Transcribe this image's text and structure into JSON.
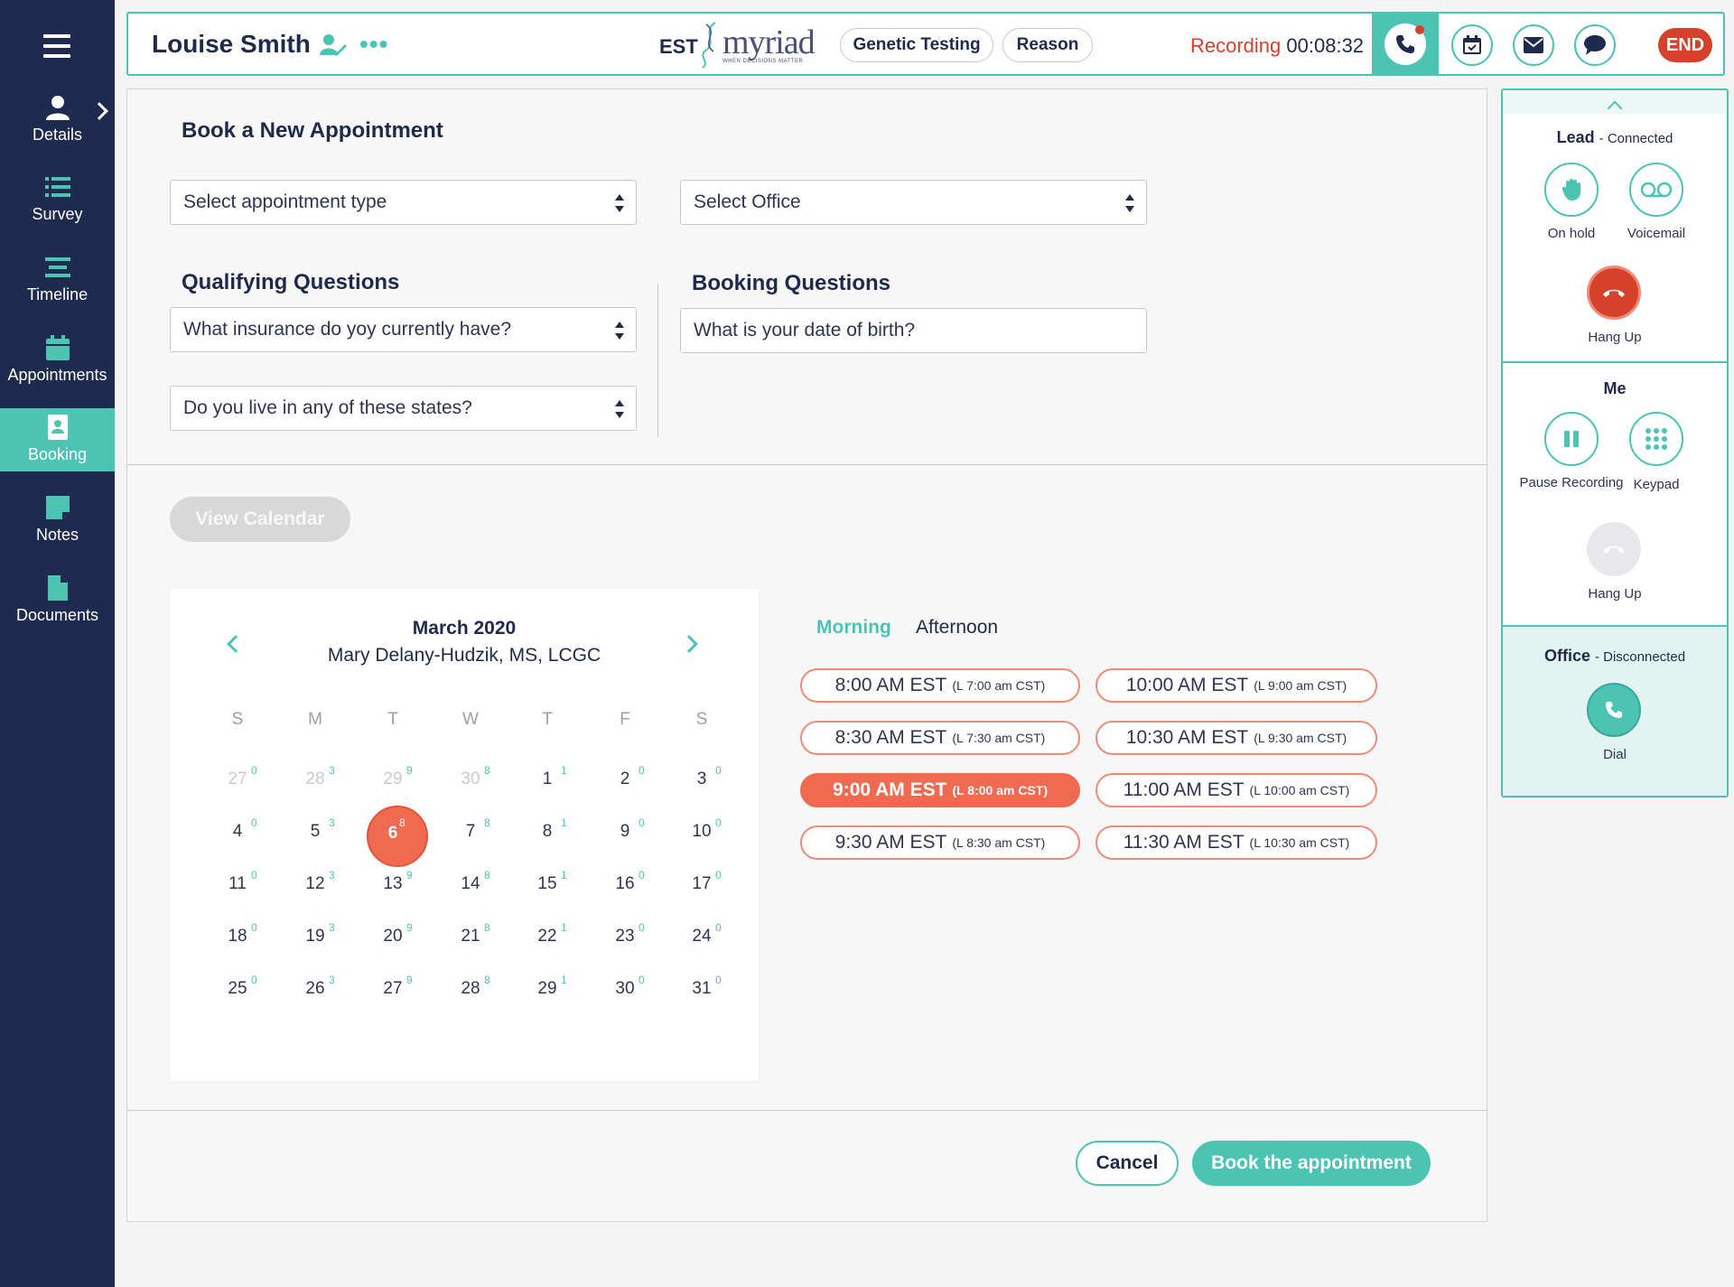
{
  "sidebar": {
    "items": [
      {
        "label": "Details"
      },
      {
        "label": "Survey"
      },
      {
        "label": "Timeline"
      },
      {
        "label": "Appointments"
      },
      {
        "label": "Booking"
      },
      {
        "label": "Notes"
      },
      {
        "label": "Documents"
      }
    ],
    "active": "Booking"
  },
  "header": {
    "patient_name": "Louise Smith",
    "timezone": "EST",
    "logo_text": "myriad",
    "logo_tagline": "WHEN DECISIONS MATTER",
    "pills": [
      "Genetic Testing",
      "Reason"
    ],
    "recording_label": "Recording",
    "recording_time": "00:08:32",
    "end_label": "END"
  },
  "booking": {
    "title": "Book a New Appointment",
    "appointment_type_placeholder": "Select appointment type",
    "office_placeholder": "Select Office",
    "qualifying_title": "Qualifying Questions",
    "qualifying_q1": "What insurance do yoy currently have?",
    "qualifying_q2": "Do you live in any of these states?",
    "booking_title": "Booking Questions",
    "booking_q1": "What is your date of birth?",
    "view_calendar": "View Calendar"
  },
  "calendar": {
    "month": "March 2020",
    "provider": "Mary Delany-Hudzik, MS, LCGC",
    "days_of_week": [
      "S",
      "M",
      "T",
      "W",
      "T",
      "F",
      "S"
    ],
    "weeks": [
      [
        {
          "d": "27",
          "c": "0",
          "f": true
        },
        {
          "d": "28",
          "c": "3",
          "f": true
        },
        {
          "d": "29",
          "c": "9",
          "f": true
        },
        {
          "d": "30",
          "c": "8",
          "f": true
        },
        {
          "d": "1",
          "c": "1"
        },
        {
          "d": "2",
          "c": "0"
        },
        {
          "d": "3",
          "c": "0"
        }
      ],
      [
        {
          "d": "4",
          "c": "0"
        },
        {
          "d": "5",
          "c": "3"
        },
        {
          "d": "6",
          "c": "8",
          "s": true
        },
        {
          "d": "7",
          "c": "8"
        },
        {
          "d": "8",
          "c": "1"
        },
        {
          "d": "9",
          "c": "0"
        },
        {
          "d": "10",
          "c": "0"
        }
      ],
      [
        {
          "d": "11",
          "c": "0"
        },
        {
          "d": "12",
          "c": "3"
        },
        {
          "d": "13",
          "c": "9"
        },
        {
          "d": "14",
          "c": "8"
        },
        {
          "d": "15",
          "c": "1"
        },
        {
          "d": "16",
          "c": "0"
        },
        {
          "d": "17",
          "c": "0"
        }
      ],
      [
        {
          "d": "18",
          "c": "0"
        },
        {
          "d": "19",
          "c": "3"
        },
        {
          "d": "20",
          "c": "9"
        },
        {
          "d": "21",
          "c": "8"
        },
        {
          "d": "22",
          "c": "1"
        },
        {
          "d": "23",
          "c": "0"
        },
        {
          "d": "24",
          "c": "0"
        }
      ],
      [
        {
          "d": "25",
          "c": "0"
        },
        {
          "d": "26",
          "c": "3"
        },
        {
          "d": "27",
          "c": "9"
        },
        {
          "d": "28",
          "c": "8"
        },
        {
          "d": "29",
          "c": "1"
        },
        {
          "d": "30",
          "c": "0"
        },
        {
          "d": "31",
          "c": "0"
        }
      ]
    ]
  },
  "slots": {
    "tab_morning": "Morning",
    "tab_afternoon": "Afternoon",
    "left": [
      {
        "time": "8:00 AM EST",
        "local": "(L 7:00 am CST)"
      },
      {
        "time": "8:30 AM EST",
        "local": "(L 7:30 am CST)"
      },
      {
        "time": "9:00 AM EST",
        "local": "(L 8:00 am CST)",
        "selected": true
      },
      {
        "time": "9:30 AM EST",
        "local": "(L 8:30 am CST)"
      }
    ],
    "right": [
      {
        "time": "10:00 AM EST",
        "local": "(L 9:00 am CST)"
      },
      {
        "time": "10:30 AM EST",
        "local": "(L 9:30 am CST)"
      },
      {
        "time": "11:00 AM EST",
        "local": "(L 10:00 am CST)"
      },
      {
        "time": "11:30 AM EST",
        "local": "(L 10:30 am CST)"
      }
    ]
  },
  "actions": {
    "cancel": "Cancel",
    "book": "Book the appointment"
  },
  "callpanel": {
    "lead_title": "Lead",
    "lead_status": "- Connected",
    "on_hold": "On hold",
    "voicemail": "Voicemail",
    "hang_up": "Hang Up",
    "me_title": "Me",
    "pause_recording": "Pause Recording",
    "keypad": "Keypad",
    "me_hang_up": "Hang Up",
    "office_title": "Office",
    "office_status": "- Disconnected",
    "dial": "Dial"
  },
  "colors": {
    "navy": "#1e2a4e",
    "teal": "#4cc4b4",
    "coral": "#f06a52",
    "red": "#d6412b"
  }
}
